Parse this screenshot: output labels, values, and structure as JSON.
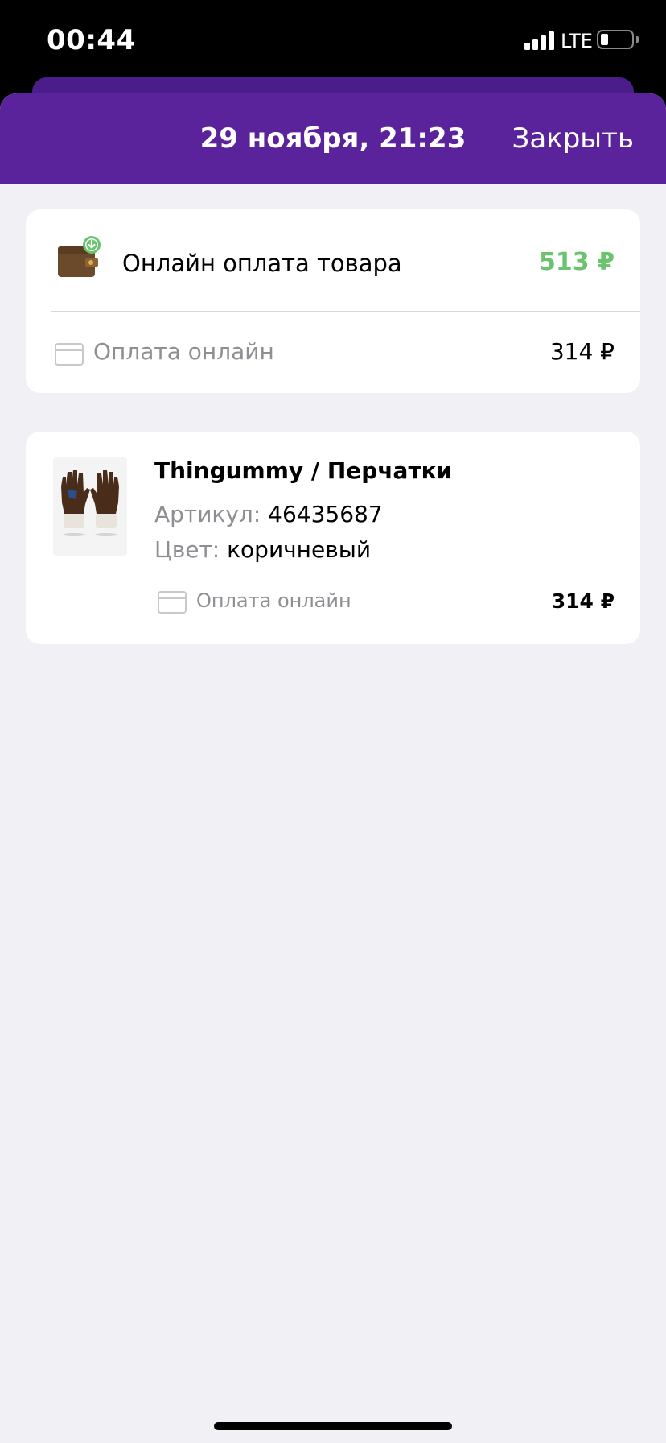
{
  "status_bar": {
    "time": "00:44",
    "network": "LTE",
    "signal_bars": 4,
    "battery_level": 0.2
  },
  "header": {
    "title": "29 ноября, 21:23",
    "close_label": "Закрыть",
    "color": "#5b239b"
  },
  "summary": {
    "icon": "wallet-icon",
    "title": "Онлайн оплата товара",
    "amount": "513 ₽",
    "amount_color": "#6ac46f",
    "payment_icon": "credit-card-icon",
    "payment_label": "Оплата онлайн",
    "payment_amount": "314 ₽"
  },
  "product": {
    "image": "gloves-thumbnail",
    "name": "Thingummy / Перчатки",
    "article_label": "Артикул:",
    "article_value": "46435687",
    "color_label": "Цвет:",
    "color_value": "коричневый",
    "payment_icon": "credit-card-icon",
    "payment_label": "Оплата онлайн",
    "payment_amount": "314 ₽"
  }
}
